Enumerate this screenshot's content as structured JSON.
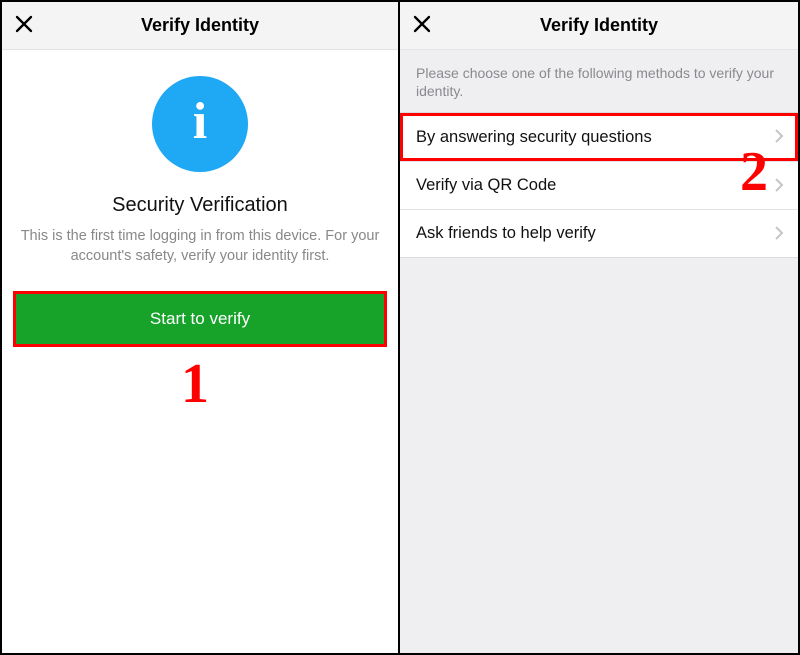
{
  "header_title": "Verify Identity",
  "left": {
    "info_badge_label": "Information",
    "title": "Security Verification",
    "desc": "This is the first time logging in from this device. For your account's safety, verify your identity first.",
    "button": "Start to verify"
  },
  "right": {
    "desc": "Please choose one of the following methods to verify your identity.",
    "options": [
      {
        "label": "By answering security questions",
        "highlight": true
      },
      {
        "label": "Verify via QR Code"
      },
      {
        "label": "Ask friends to help verify"
      }
    ]
  },
  "callouts": {
    "one": "1",
    "two": "2"
  }
}
